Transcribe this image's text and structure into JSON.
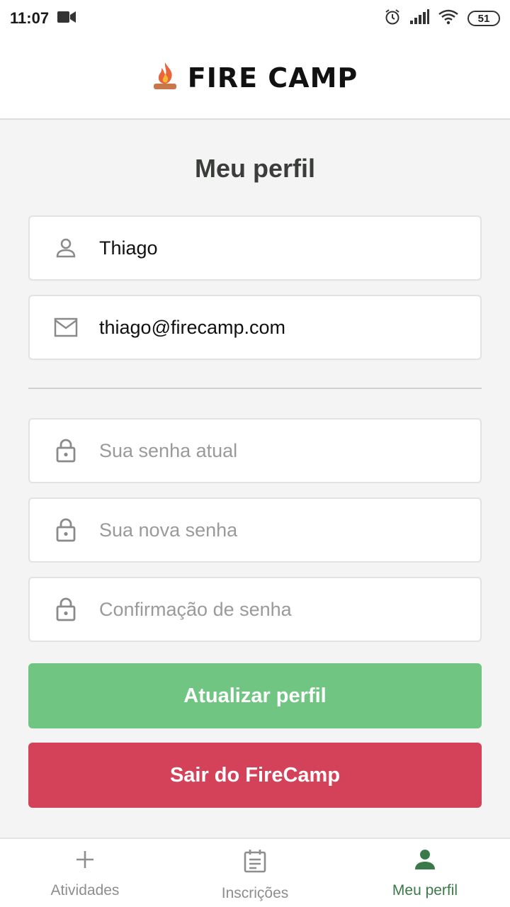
{
  "status": {
    "time": "11:07",
    "battery": "51"
  },
  "header": {
    "app_name": "FIRE CAMP"
  },
  "page": {
    "title": "Meu perfil"
  },
  "form": {
    "name_value": "Thiago",
    "email_value": "thiago@firecamp.com",
    "current_password_placeholder": "Sua senha atual",
    "new_password_placeholder": "Sua nova senha",
    "confirm_password_placeholder": "Confirmação de senha"
  },
  "buttons": {
    "update_label": "Atualizar perfil",
    "logout_label": "Sair do FireCamp"
  },
  "tabs": [
    {
      "label": "Atividades",
      "icon": "plus-icon"
    },
    {
      "label": "Inscrições",
      "icon": "calendar-icon"
    },
    {
      "label": "Meu perfil",
      "icon": "user-icon",
      "active": true
    }
  ],
  "colors": {
    "update_button": "#71c582",
    "logout_button": "#d4425a",
    "active_tab": "#3a7a4a"
  }
}
